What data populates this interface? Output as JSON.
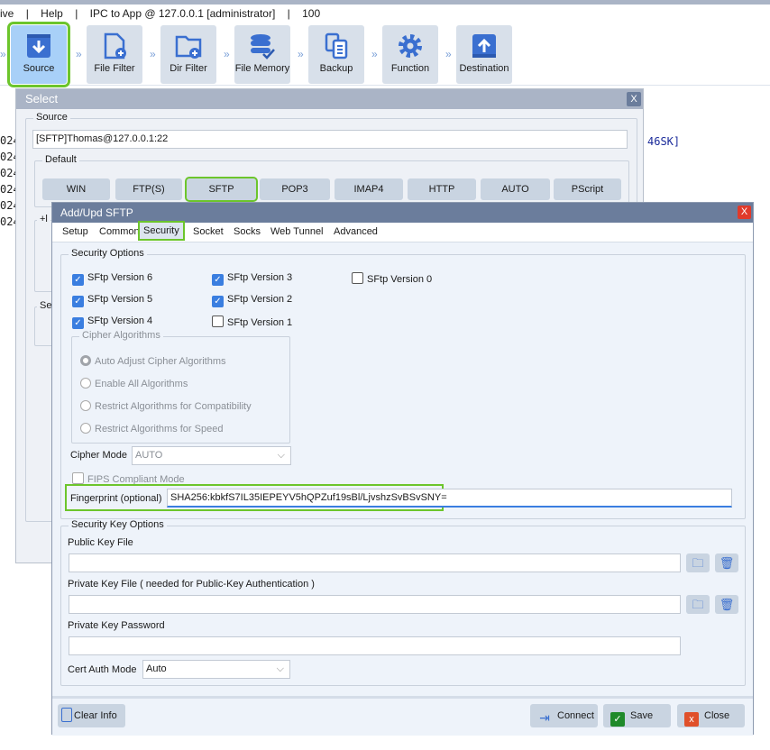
{
  "menubar": {
    "items": [
      "ive",
      "|",
      "Help",
      "|",
      "IPC to App @ 127.0.0.1 [administrator]",
      "|",
      "100"
    ]
  },
  "toolbar": {
    "buttons": [
      {
        "label": "Source",
        "icon": "download-box-icon",
        "active": true
      },
      {
        "label": "File Filter",
        "icon": "file-add-icon"
      },
      {
        "label": "Dir Filter",
        "icon": "folder-add-icon"
      },
      {
        "label": "File Memory",
        "icon": "database-check-icon"
      },
      {
        "label": "Backup",
        "icon": "copy-documents-icon"
      },
      {
        "label": "Function",
        "icon": "gear-icon"
      },
      {
        "label": "Destination",
        "icon": "upload-box-icon"
      }
    ]
  },
  "background_log": {
    "lines": [
      "024",
      "024",
      "024",
      "024",
      "024",
      "024"
    ],
    "right_fragment": "46SK]"
  },
  "select_dialog": {
    "title": "Select",
    "close": "X",
    "source_group": "Source",
    "source_value": "[SFTP]Thomas@127.0.0.1:22",
    "default_group": "Default",
    "protocols": [
      "WIN",
      "FTP(S)",
      "SFTP",
      "POP3",
      "IMAP4",
      "HTTP",
      "AUTO",
      "PScript"
    ],
    "selected_protocol": "SFTP",
    "other_group_fragment": "+l",
    "se_fragment": "Se"
  },
  "sftp_dialog": {
    "title": "Add/Upd SFTP",
    "close": "X",
    "tabs": [
      "Setup",
      "Common",
      "Security",
      "Socket",
      "Socks",
      "Web Tunnel",
      "Advanced"
    ],
    "active_tab": "Security",
    "security_options": {
      "label": "Security Options",
      "versions": [
        {
          "label": "SFtp Version 6",
          "checked": true
        },
        {
          "label": "SFtp Version 5",
          "checked": true
        },
        {
          "label": "SFtp Version 4",
          "checked": true
        },
        {
          "label": "SFtp Version 3",
          "checked": true
        },
        {
          "label": "SFtp Version 2",
          "checked": true
        },
        {
          "label": "SFtp Version 1",
          "checked": false
        },
        {
          "label": "SFtp Version 0",
          "checked": false
        }
      ]
    },
    "cipher_algorithms": {
      "label": "Cipher Algorithms",
      "options": [
        "Auto Adjust Cipher Algorithms",
        "Enable All Algorithms",
        "Restrict Algorithms for Compatibility",
        "Restrict Algorithms for Speed"
      ],
      "selected": "Auto Adjust Cipher Algorithms"
    },
    "cipher_mode": {
      "label": "Cipher Mode",
      "value": "AUTO"
    },
    "fips": {
      "label": "FIPS Compliant Mode",
      "checked": false
    },
    "fingerprint": {
      "label": "Fingerprint (optional)",
      "value": "SHA256:kbkfS7IL35IEPEYV5hQPZuf19sBl/LjvshzSvBSvSNY="
    },
    "security_key_options": {
      "label": "Security Key Options",
      "public_key_label": "Public Key File",
      "public_key_value": "",
      "private_key_label": "Private Key File ( needed for Public-Key Authentication )",
      "private_key_value": "",
      "password_label": "Private Key Password",
      "password_value": "",
      "cert_auth_label": "Cert Auth Mode",
      "cert_auth_value": "Auto"
    },
    "footer": {
      "clear_info": "Clear Info",
      "connect": "Connect",
      "save": "Save",
      "close": "Close"
    }
  },
  "colors": {
    "highlight": "#6cc52c",
    "accent": "#3a7ee0",
    "title_bar": "#6b7d9c"
  }
}
